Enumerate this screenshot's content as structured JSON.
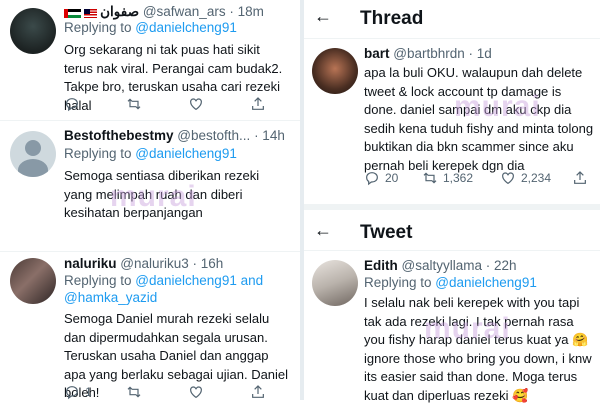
{
  "left_tweets": [
    {
      "display_name": "صفوان",
      "handle": "@safwan_ars",
      "time": "· 18m",
      "replying_prefix": "Replying to ",
      "replying_handles": "@danielcheng91",
      "text": "Org sekarang ni tak puas hati sikit terus nak viral. Perangai cam budak2. Takpe bro, teruskan usaha cari rezeki halal"
    },
    {
      "display_name": "Bestofthebestmy",
      "handle": "@bestofth...",
      "time": "· 14h",
      "replying_prefix": "Replying to ",
      "replying_handles": "@danielcheng91",
      "text": "Semoga sentiasa diberikan rezeki yang melimpah ruah dan diberi kesihatan berpanjangan"
    },
    {
      "display_name": "naluriku",
      "handle": "@naluriku3",
      "time": "· 16h",
      "replying_prefix": "Replying to ",
      "replying_handles": "@danielcheng91 and",
      "replying_handles_2": "@hamka_yazid",
      "text": "Semoga Daniel murah rezeki selalu dan dipermudahkan segala urusan. Teruskan usaha Daniel dan anggap apa yang berlaku sebagai ujian. Daniel boleh!",
      "reply_count": "1"
    }
  ],
  "thread": {
    "title": "Thread",
    "display_name": "bart",
    "handle": "@bartbhrdn",
    "time": "· 1d",
    "text": "apa la buli OKU. walaupun dah delete tweet & lock account tp damage is done. daniel sampai dm aku ckp dia sedih kena tuduh fishy and minta tolong buktikan dia bkn scammer since aku pernah beli kerepek dgn dia",
    "reply_count": "20",
    "retweet_count": "1,362",
    "like_count": "2,234"
  },
  "tweet": {
    "title": "Tweet",
    "display_name": "Edith",
    "handle": "@saltyyllama",
    "time": "· 22h",
    "replying_prefix": "Replying to ",
    "replying_handles": "@danielcheng91",
    "text": "I selalu nak beli kerepek with you tapi tak ada rezeki lagi. I tak pernah rasa you fishy harap daniel terus kuat ya 🤗 ignore those who bring you down, i knw its easier said than done. Moga terus kuat dan diperluas rezeki 🥰"
  },
  "watermark": "murai",
  "colors": {
    "accent": "#1d9bf0",
    "muted": "#536471",
    "text": "#0f1419"
  }
}
